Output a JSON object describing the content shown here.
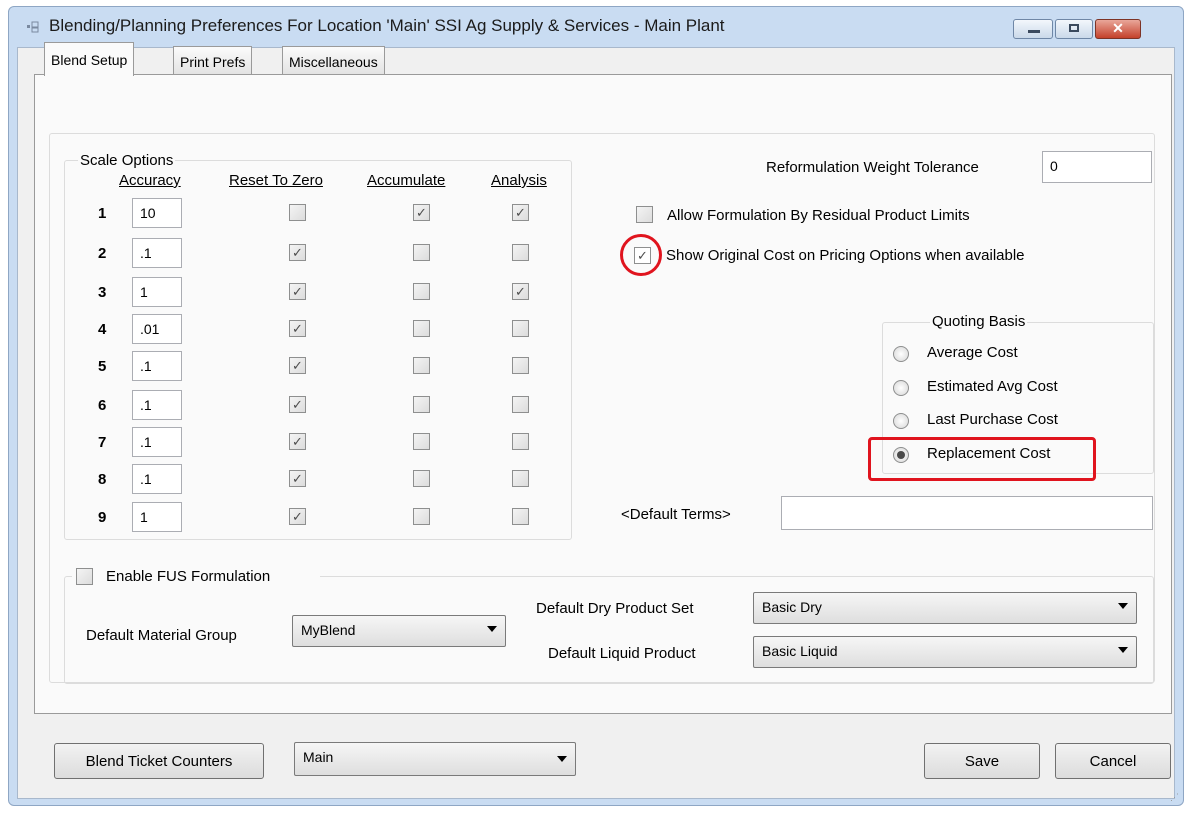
{
  "window": {
    "title": "Blending/Planning Preferences For Location 'Main' SSI Ag Supply & Services - Main Plant",
    "buttons": [
      "minimize-icon",
      "maximize-icon",
      "close-icon"
    ]
  },
  "tabs": [
    {
      "label": "Blend Setup",
      "active": true
    },
    {
      "label": "Print Prefs",
      "active": false
    },
    {
      "label": "Miscellaneous",
      "active": false
    }
  ],
  "scale_options": {
    "title": "Scale Options",
    "headers": {
      "accuracy": "Accuracy",
      "reset": "Reset To Zero",
      "accumulate": "Accumulate",
      "analysis": "Analysis"
    },
    "rows": [
      {
        "num": "1",
        "accuracy": "10",
        "reset": false,
        "accumulate": true,
        "analysis": true
      },
      {
        "num": "2",
        "accuracy": ".1",
        "reset": true,
        "accumulate": false,
        "analysis": false
      },
      {
        "num": "3",
        "accuracy": "1",
        "reset": true,
        "accumulate": false,
        "analysis": true
      },
      {
        "num": "4",
        "accuracy": ".01",
        "reset": true,
        "accumulate": false,
        "analysis": false
      },
      {
        "num": "5",
        "accuracy": ".1",
        "reset": true,
        "accumulate": false,
        "analysis": false
      },
      {
        "num": "6",
        "accuracy": ".1",
        "reset": true,
        "accumulate": false,
        "analysis": false
      },
      {
        "num": "7",
        "accuracy": ".1",
        "reset": true,
        "accumulate": false,
        "analysis": false
      },
      {
        "num": "8",
        "accuracy": ".1",
        "reset": true,
        "accumulate": false,
        "analysis": false
      },
      {
        "num": "9",
        "accuracy": "1",
        "reset": true,
        "accumulate": false,
        "analysis": false
      }
    ]
  },
  "reformulation": {
    "label": "Reformulation Weight Tolerance",
    "value": "0"
  },
  "allow_formulation": {
    "label": "Allow Formulation By Residual Product Limits",
    "checked": false
  },
  "show_original_cost": {
    "label": "Show Original Cost on Pricing Options when available",
    "checked": true
  },
  "quoting_basis": {
    "title": "Quoting Basis",
    "options": [
      {
        "label": "Average Cost",
        "selected": false
      },
      {
        "label": "Estimated Avg Cost",
        "selected": false
      },
      {
        "label": "Last Purchase Cost",
        "selected": false
      },
      {
        "label": "Replacement Cost",
        "selected": true
      }
    ]
  },
  "default_terms": {
    "label": "<Default Terms>",
    "value": ""
  },
  "fus": {
    "enable_label": "Enable FUS Formulation",
    "enabled": false,
    "material_group_label": "Default Material Group",
    "material_group_value": "MyBlend",
    "dry_set_label": "Default Dry Product Set",
    "dry_set_value": "Basic Dry",
    "liquid_label": "Default Liquid Product",
    "liquid_value": "Basic Liquid"
  },
  "bottom": {
    "counters_button": "Blend Ticket Counters",
    "location_value": "Main",
    "save_button": "Save",
    "cancel_button": "Cancel"
  },
  "annotation_color": "#e0141e"
}
